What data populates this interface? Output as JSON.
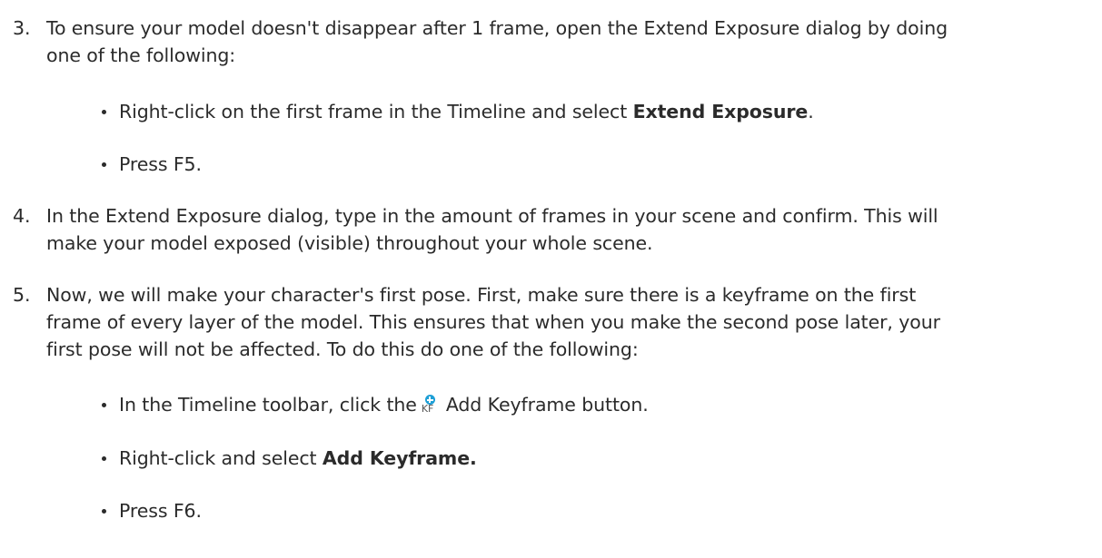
{
  "steps": [
    {
      "number": "3.",
      "lines": [
        "To ensure your model doesn't disappear after 1 frame, open the Extend Exposure dialog by doing",
        "one of the following:"
      ],
      "bullets": [
        {
          "text_before": "Right-click on the first frame in the Timeline and select ",
          "bold": "Extend Exposure",
          "text_after": "."
        },
        {
          "text": "Press F5."
        }
      ]
    },
    {
      "number": "4.",
      "lines": [
        "In the Extend Exposure dialog, type in the amount of frames in your scene and confirm. This will",
        "make your model exposed (visible) throughout your whole scene."
      ]
    },
    {
      "number": "5.",
      "lines": [
        "Now, we will make your character's first pose. First, make sure there is a keyframe on the first",
        "frame of every layer of the model. This ensures that when you make the second pose later, your",
        "first pose will not be affected. To do this do one of the following:"
      ],
      "bullets": [
        {
          "text_before": "In the Timeline toolbar, click the",
          "icon": "add-keyframe-icon",
          "icon_label": "KF",
          "text_after": "Add Keyframe button."
        },
        {
          "text_before": "Right-click and select ",
          "bold": "Add Keyframe."
        },
        {
          "text": "Press F6."
        }
      ]
    }
  ]
}
